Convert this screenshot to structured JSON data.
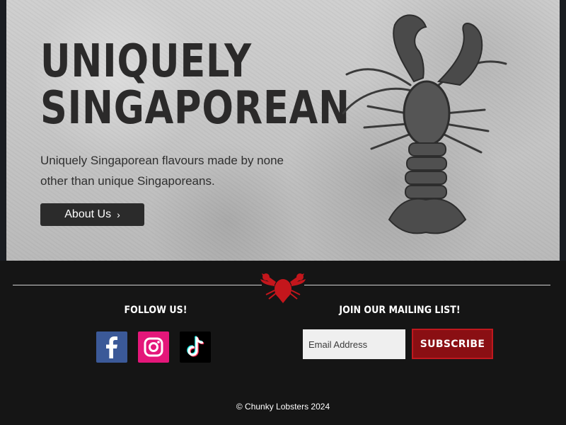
{
  "hero": {
    "title_line1": "UNIQUELY",
    "title_line2": "SINGAPOREAN",
    "subtitle": "Uniquely Singaporean flavours made by none other than unique Singaporeans.",
    "about_button": {
      "label": "About Us",
      "chevron": "›"
    },
    "decoration_icon": "lobster-stencil-icon"
  },
  "footer": {
    "divider_icon": "lobster-icon",
    "follow": {
      "title": "FOLLOW US!",
      "links": [
        {
          "icon": "facebook-icon",
          "color": "#3b5998"
        },
        {
          "icon": "instagram-icon",
          "color": "#e4177a"
        },
        {
          "icon": "tiktok-icon",
          "color": "#000000"
        }
      ]
    },
    "mailing": {
      "title": "JOIN OUR MAILING LIST!",
      "email_placeholder": "Email Address",
      "email_value": "",
      "subscribe_label": "SUBSCRIBE"
    },
    "copyright": "© Chunky Lobsters 2024"
  },
  "colors": {
    "footer_bg": "#151515",
    "button_dark": "#2b2b2b",
    "subscribe_red": "#8a0f13",
    "lobster_red": "#c4161c"
  }
}
